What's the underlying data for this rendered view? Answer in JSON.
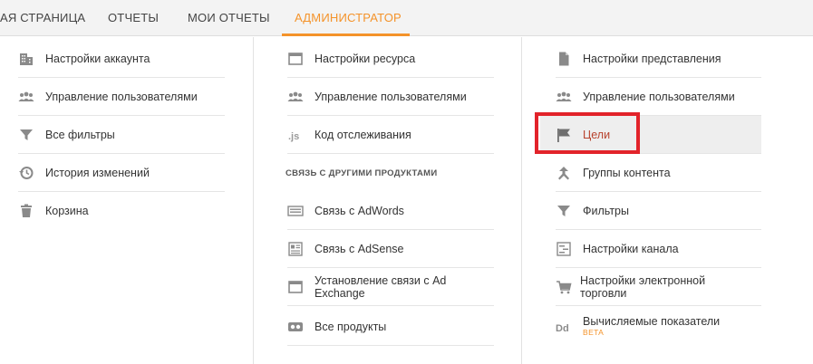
{
  "nav": {
    "tabs": [
      {
        "label": "АЯ СТРАНИЦА"
      },
      {
        "label": "ОТЧЕТЫ"
      },
      {
        "label": "МОИ ОТЧЕТЫ"
      },
      {
        "label": "АДМИНИСТРАТОР"
      }
    ],
    "active_color": "#f4932a"
  },
  "account": {
    "items": [
      {
        "label": "Настройки аккаунта",
        "icon": "building-icon"
      },
      {
        "label": "Управление пользователями",
        "icon": "users-icon"
      },
      {
        "label": "Все фильтры",
        "icon": "filter-icon"
      },
      {
        "label": "История изменений",
        "icon": "history-icon"
      },
      {
        "label": "Корзина",
        "icon": "trash-icon"
      }
    ]
  },
  "property": {
    "items": [
      {
        "label": "Настройки ресурса",
        "icon": "window-icon"
      },
      {
        "label": "Управление пользователями",
        "icon": "users-icon"
      },
      {
        "label": "Код отслеживания",
        "icon": "js-icon"
      }
    ],
    "section_title": "СВЯЗЬ С ДРУГИМИ ПРОДУКТАМИ",
    "links": [
      {
        "label": "Связь с AdWords",
        "icon": "adwords-icon"
      },
      {
        "label": "Связь с AdSense",
        "icon": "adsense-icon"
      },
      {
        "label": "Установление связи с Ad Exchange",
        "icon": "adexchange-icon"
      },
      {
        "label": "Все продукты",
        "icon": "products-icon"
      }
    ]
  },
  "view": {
    "items": [
      {
        "label": "Настройки представления",
        "icon": "document-icon"
      },
      {
        "label": "Управление пользователями",
        "icon": "users-icon"
      },
      {
        "label": "Цели",
        "icon": "flag-icon"
      },
      {
        "label": "Группы контента",
        "icon": "content-groups-icon"
      },
      {
        "label": "Фильтры",
        "icon": "filter-icon"
      },
      {
        "label": "Настройки канала",
        "icon": "channel-icon"
      },
      {
        "label": "Настройки электронной торговли",
        "icon": "cart-icon"
      },
      {
        "label": "Вычисляемые показатели",
        "icon": "dd-icon",
        "badge": "BETA"
      }
    ],
    "highlight_color": "#e2232a"
  }
}
